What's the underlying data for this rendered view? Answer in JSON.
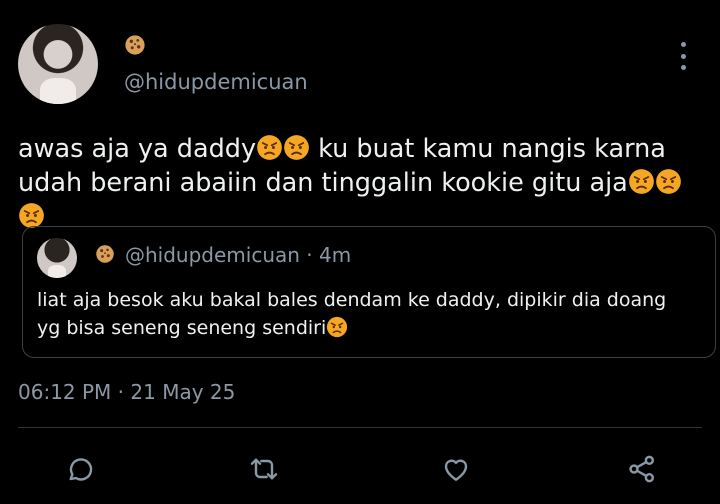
{
  "tweet": {
    "display_name_icon": "cookie-emoji",
    "handle": "@hidupdemicuan",
    "line1_prefix": "awas aja ya daddy",
    "line1_suffix": " ku buat kamu nangis karna",
    "line2_text": "udah berani abaiin dan tinggalin kookie gitu aja",
    "timestamp": "06:12 PM · 21 May 25"
  },
  "quoted": {
    "display_name_icon": "cookie-emoji",
    "meta": "@hidupdemicuan · 4m",
    "line1": "liat aja besok aku bakal bales dendam ke daddy, dipikir dia doang",
    "line2": "yg bisa seneng seneng sendiri"
  },
  "actions": [
    "reply-icon",
    "retweet-icon",
    "like-icon",
    "share-icon"
  ],
  "colors": {
    "background": "#000000",
    "text": "#e7e9ea",
    "secondary": "#8b98a5",
    "border": "#3b3f44"
  }
}
